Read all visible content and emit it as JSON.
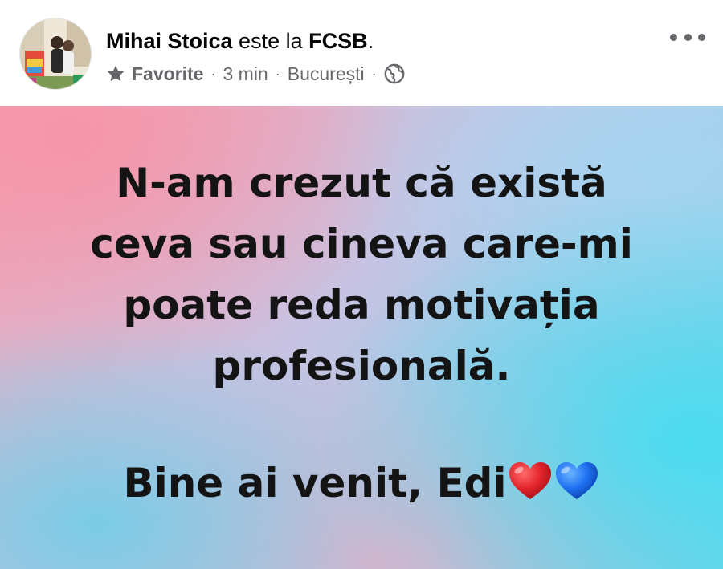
{
  "post": {
    "author_name": "Mihai Stoica",
    "action_text": "este la",
    "place": "FCSB",
    "place_suffix": ".",
    "audience": "Favorite",
    "time": "3 min",
    "location": "București",
    "separator": "·",
    "icons": {
      "audience": "star-icon",
      "privacy": "globe-icon",
      "menu": "more-options-icon"
    }
  },
  "status": {
    "lines": [
      "N-am crezut că există",
      "ceva sau cineva care-mi",
      "poate reda motivația",
      "profesională."
    ],
    "closing": "Bine ai venit, Edi",
    "emoji": [
      "red-heart-icon",
      "blue-heart-icon"
    ]
  },
  "colors": {
    "heart_red": "#e3242b",
    "heart_blue": "#1e6ff2",
    "meta_gray": "#65676b",
    "text": "#141414"
  }
}
